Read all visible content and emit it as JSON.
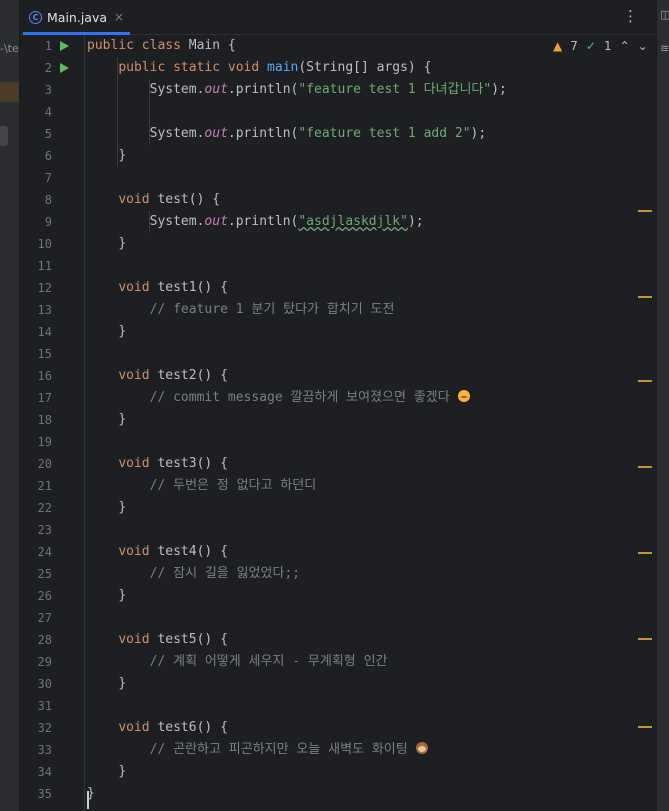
{
  "left_panel": {
    "crumb": "-\\te"
  },
  "tab": {
    "label": "Main.java",
    "close": "×",
    "icon_letter": "C"
  },
  "more_label": "⋮",
  "inspections": {
    "warnings": "7",
    "weak_warnings": "1",
    "up": "⌃",
    "down": "⌄"
  },
  "right_panel": {
    "icon_a": "◫",
    "icon_b": "≋"
  },
  "lines": [
    {
      "n": "1"
    },
    {
      "n": "2"
    },
    {
      "n": "3"
    },
    {
      "n": "4"
    },
    {
      "n": "5"
    },
    {
      "n": "6"
    },
    {
      "n": "7"
    },
    {
      "n": "8"
    },
    {
      "n": "9"
    },
    {
      "n": "10"
    },
    {
      "n": "11"
    },
    {
      "n": "12"
    },
    {
      "n": "13"
    },
    {
      "n": "14"
    },
    {
      "n": "15"
    },
    {
      "n": "16"
    },
    {
      "n": "17"
    },
    {
      "n": "18"
    },
    {
      "n": "19"
    },
    {
      "n": "20"
    },
    {
      "n": "21"
    },
    {
      "n": "22"
    },
    {
      "n": "23"
    },
    {
      "n": "24"
    },
    {
      "n": "25"
    },
    {
      "n": "26"
    },
    {
      "n": "27"
    },
    {
      "n": "28"
    },
    {
      "n": "29"
    },
    {
      "n": "30"
    },
    {
      "n": "31"
    },
    {
      "n": "32"
    },
    {
      "n": "33"
    },
    {
      "n": "34"
    },
    {
      "n": "35"
    }
  ],
  "code": {
    "l1_public": "public",
    "l1_class": "class",
    "l1_name": " Main {",
    "l2_public": "public",
    "l2_static": "static",
    "l2_void": "void",
    "l2_main": "main",
    "l2_rest": "(String[] args) {",
    "sys": "System.",
    "out": "out",
    "println": ".println(",
    "s3": "\"feature test 1 다녀갑니다\"",
    "s5": "\"feature test 1 add 2\"",
    "s9": "\"asdjlaskdjlk\"",
    "end": ");",
    "close_brace": "}",
    "void": "void",
    "m_test": " test() {",
    "m_test1": " test1() {",
    "m_test2": " test2() {",
    "m_test3": " test3() {",
    "m_test4": " test4() {",
    "m_test5": " test5() {",
    "m_test6": " test6() {",
    "c13": "// feature 1 분기 탔다가 합치기 도전",
    "c17": "// commit message 깔끔하게 보여졌으면 좋겠다 ",
    "c21": "// 두번은 정 없다고 하던디",
    "c25": "// 잠시 길을 잃었었다;;",
    "c29": "// 계획 어떻게 세우지 - 무계획형 인간",
    "c33": "// 곤란하고 피곤하지만 오늘 새벽도 화이팅 "
  },
  "colors": {
    "keyword": "#cf8e6d",
    "string": "#6aab73",
    "comment": "#7a7e85",
    "method": "#56a8f5",
    "accent": "#3574f0"
  }
}
